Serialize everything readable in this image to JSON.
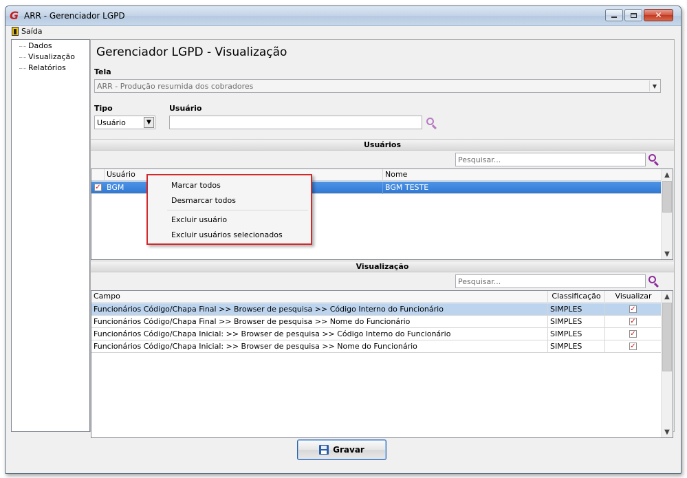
{
  "window": {
    "title": "ARR - Gerenciador LGPD",
    "logo_letter": "G"
  },
  "menu": {
    "saida_label": "Saída"
  },
  "tree": {
    "items": [
      "Dados",
      "Visualização",
      "Relatórios"
    ]
  },
  "main": {
    "page_title": "Gerenciador LGPD - Visualização",
    "tela_label": "Tela",
    "tela_value": "ARR - Produção resumida dos cobradores",
    "tipo_label": "Tipo",
    "tipo_value": "Usuário",
    "usuario_label": "Usuário",
    "usuario_value": ""
  },
  "usuarios": {
    "header": "Usuários",
    "search_placeholder": "Pesquisar...",
    "columns": [
      "Usuário",
      "Nome"
    ],
    "rows": [
      {
        "usuario": "BGM",
        "nome": "BGM TESTE",
        "checked": true
      }
    ]
  },
  "context_menu": {
    "items": [
      "Marcar todos",
      "Desmarcar todos",
      "Excluir usuário",
      "Excluir usuários selecionados"
    ]
  },
  "visualizacao": {
    "header": "Visualização",
    "search_placeholder": "Pesquisar...",
    "columns": [
      "Campo",
      "Classificação",
      "Visualizar"
    ],
    "rows": [
      {
        "campo": "Funcionários Código/Chapa Final >> Browser de pesquisa >> Código Interno do Funcionário",
        "classificacao": "SIMPLES",
        "visualizar": true
      },
      {
        "campo": "Funcionários Código/Chapa Final >> Browser de pesquisa >> Nome do Funcionário",
        "classificacao": "SIMPLES",
        "visualizar": true
      },
      {
        "campo": "Funcionários Código/Chapa Inicial: >> Browser de pesquisa >> Código Interno do Funcionário",
        "classificacao": "SIMPLES",
        "visualizar": true
      },
      {
        "campo": "Funcionários Código/Chapa Inicial: >> Browser de pesquisa >> Nome do Funcionário",
        "classificacao": "SIMPLES",
        "visualizar": true
      }
    ]
  },
  "footer": {
    "gravar_label": "Gravar"
  },
  "colors": {
    "selection_blue": "#2f78d4",
    "selection_light": "#bcd4ee",
    "accent_red": "#d22a2a",
    "search_purple": "#8e2c9c"
  }
}
